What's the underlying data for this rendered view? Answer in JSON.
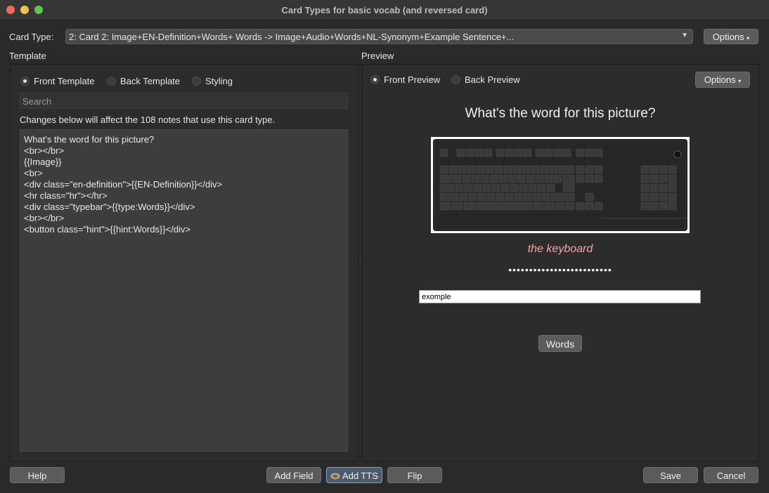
{
  "window": {
    "title": "Card Types for basic vocab (and reversed card)"
  },
  "card_type": {
    "label": "Card Type:",
    "value": "2: Card 2: Image+EN-Definition+Words+ Words -> Image+Audio+Words+NL-Synonym+Example Sentence+...",
    "options_label": "Options"
  },
  "template": {
    "section_label": "Template",
    "radios": [
      {
        "label": "Front Template",
        "selected": true
      },
      {
        "label": "Back Template",
        "selected": false
      },
      {
        "label": "Styling",
        "selected": false
      }
    ],
    "search_placeholder": "Search",
    "notice": "Changes below will affect the 108 notes that use this card type.",
    "code_lines": [
      "What's the word for this picture?",
      "<br></br>",
      "{{Image}}",
      "<br>",
      "<div class=\"en-definition\">{{EN-Definition}}</div>",
      "<hr class=\"hr\"></hr>",
      "<div class=\"typebar\">{{type:Words}}</div>",
      "<br></br>",
      "<button class=\"hint\">{{hint:Words}}</div>"
    ]
  },
  "preview": {
    "section_label": "Preview",
    "radios": [
      {
        "label": "Front Preview",
        "selected": true
      },
      {
        "label": "Back Preview",
        "selected": false
      }
    ],
    "options_label": "Options",
    "question": "What's the word for this picture?",
    "definition": "the keyboard",
    "hint_dots": "•••••••••••••••••••••••••",
    "type_answer_value": "exomple",
    "hint_button_label": "Words"
  },
  "buttons": {
    "help": "Help",
    "add_field": "Add Field",
    "add_tts": "Add TTS",
    "flip": "Flip",
    "save": "Save",
    "cancel": "Cancel"
  },
  "colors": {
    "background": "#2a2a2a",
    "definition_text": "#f5a5a5",
    "button_bg": "#5b5b5b"
  }
}
